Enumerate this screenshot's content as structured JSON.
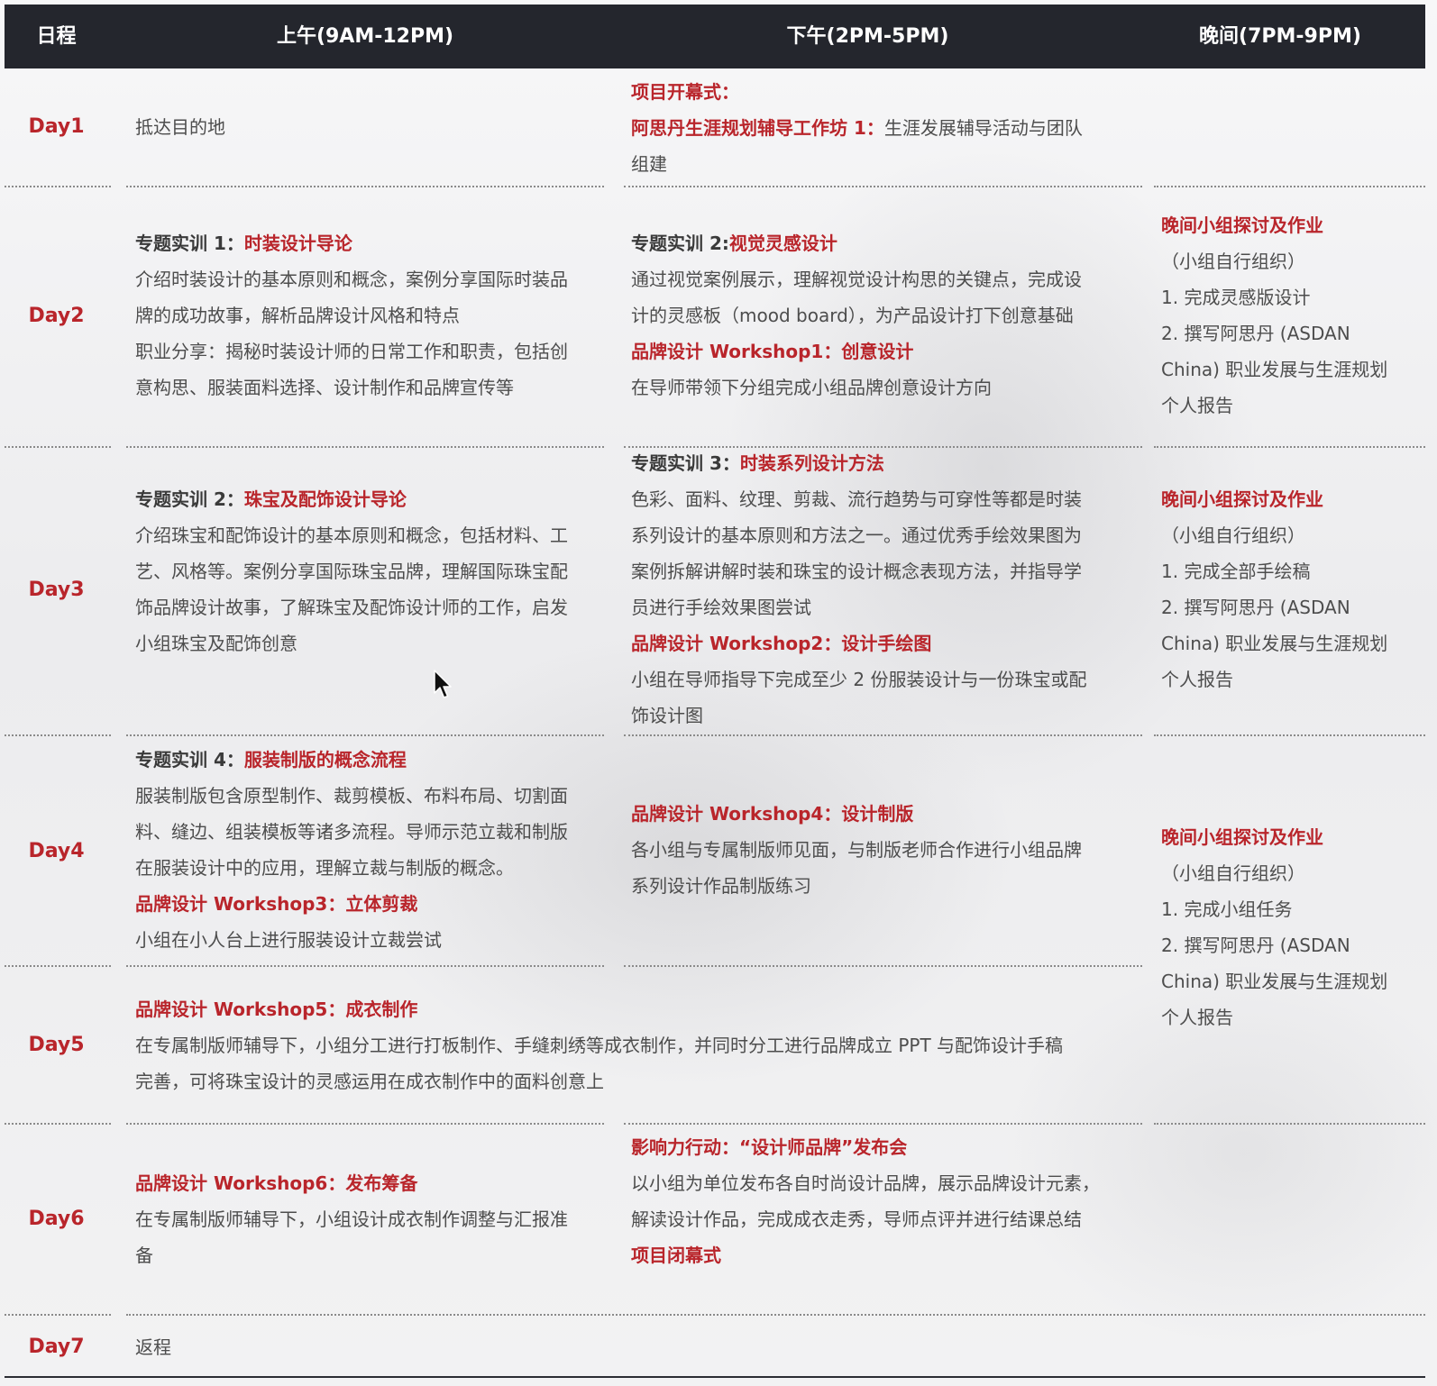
{
  "header": {
    "col_day": "日程",
    "col_morning": "上午(9AM-12PM)",
    "col_afternoon": "下午(2PM-5PM)",
    "col_evening": "晚间(7PM-9PM)"
  },
  "days": {
    "d1": {
      "label": "Day1",
      "morning": "抵达目的地",
      "afternoon_title1": "项目开幕式：",
      "afternoon_title2": "阿思丹生涯规划辅导工作坊 1：",
      "afternoon_text": "生涯发展辅导活动与团队",
      "afternoon_text2": "组建"
    },
    "d2": {
      "label": "Day2",
      "morning_prefix": "专题实训 1：",
      "morning_title": "时装设计导论",
      "morning_l1": "介绍时装设计的基本原则和概念，案例分享国际时装品",
      "morning_l2": "牌的成功故事，解析品牌设计风格和特点",
      "morning_l3": "职业分享：揭秘时装设计师的日常工作和职责，包括创",
      "morning_l4": "意构思、服装面料选择、设计制作和品牌宣传等",
      "afternoon_prefix": "专题实训 2:",
      "afternoon_title": "视觉灵感设计",
      "afternoon_l1": "通过视觉案例展示，理解视觉设计构思的关键点，完成设",
      "afternoon_l2": "计的灵感板（mood board），为产品设计打下创意基础",
      "afternoon_ws": "品牌设计 Workshop1：创意设计",
      "afternoon_l3": "在导师带领下分组完成小组品牌创意设计方向",
      "evening_title": "晚间小组探讨及作业",
      "evening_l1": "（小组自行组织）",
      "evening_l2": "1. 完成灵感版设计",
      "evening_l3": "2. 撰写阿思丹 (ASDAN",
      "evening_l4": "China) 职业发展与生涯规划",
      "evening_l5": "个人报告"
    },
    "d3": {
      "label": "Day3",
      "morning_prefix": "专题实训 2：",
      "morning_title": "珠宝及配饰设计导论",
      "morning_l1": "介绍珠宝和配饰设计的基本原则和概念，包括材料、工",
      "morning_l2": "艺、风格等。案例分享国际珠宝品牌，理解国际珠宝配",
      "morning_l3": "饰品牌设计故事，了解珠宝及配饰设计师的工作，启发",
      "morning_l4": "小组珠宝及配饰创意",
      "afternoon_prefix": "专题实训 3：",
      "afternoon_title": "时装系列设计方法",
      "afternoon_l1": "色彩、面料、纹理、剪裁、流行趋势与可穿性等都是时装",
      "afternoon_l2": "系列设计的基本原则和方法之一。通过优秀手绘效果图为",
      "afternoon_l3": "案例拆解讲解时装和珠宝的设计概念表现方法，并指导学",
      "afternoon_l4": "员进行手绘效果图尝试",
      "afternoon_ws": "品牌设计 Workshop2：设计手绘图",
      "afternoon_l5": "小组在导师指导下完成至少 2 份服装设计与一份珠宝或配",
      "afternoon_l6": "饰设计图",
      "evening_title": "晚间小组探讨及作业",
      "evening_l1": "（小组自行组织）",
      "evening_l2": "1. 完成全部手绘稿",
      "evening_l3": "2. 撰写阿思丹 (ASDAN",
      "evening_l4": "China) 职业发展与生涯规划",
      "evening_l5": "个人报告"
    },
    "d4": {
      "label": "Day4",
      "morning_prefix": "专题实训 4：",
      "morning_title": "服装制版的概念流程",
      "morning_l1": "服装制版包含原型制作、裁剪模板、布料布局、切割面",
      "morning_l2": "料、缝边、组装模板等诸多流程。导师示范立裁和制版",
      "morning_l3": "在服装设计中的应用，理解立裁与制版的概念。",
      "morning_ws": "品牌设计 Workshop3：立体剪裁",
      "morning_l4": "小组在小人台上进行服装设计立裁尝试",
      "afternoon_ws": "品牌设计 Workshop4：设计制版",
      "afternoon_l1": "各小组与专属制版师见面，与制版老师合作进行小组品牌",
      "afternoon_l2": "系列设计作品制版练习",
      "evening_title": "晚间小组探讨及作业",
      "evening_l1": "（小组自行组织）",
      "evening_l2": "1. 完成小组任务",
      "evening_l3": "2. 撰写阿思丹 (ASDAN",
      "evening_l4": "China) 职业发展与生涯规划",
      "evening_l5": "个人报告"
    },
    "d5": {
      "label": "Day5",
      "ws": "品牌设计 Workshop5：成衣制作",
      "l1": "在专属制版师辅导下，小组分工进行打板制作、手缝刺绣等成衣制作，并同时分工进行品牌成立 PPT 与配饰设计手稿",
      "l2": "完善，可将珠宝设计的灵感运用在成衣制作中的面料创意上"
    },
    "d6": {
      "label": "Day6",
      "morning_ws": "品牌设计 Workshop6：发布筹备",
      "morning_l1": "在专属制版师辅导下，小组设计成衣制作调整与汇报准",
      "morning_l2": "备",
      "afternoon_title": "影响力行动：“设计师品牌”发布会",
      "afternoon_l1": "以小组为单位发布各自时尚设计品牌，展示品牌设计元素，",
      "afternoon_l2": "解读设计作品，完成成衣走秀，导师点评并进行结课总结",
      "afternoon_close": "项目闭幕式"
    },
    "d7": {
      "label": "Day7",
      "morning": "返程"
    }
  }
}
